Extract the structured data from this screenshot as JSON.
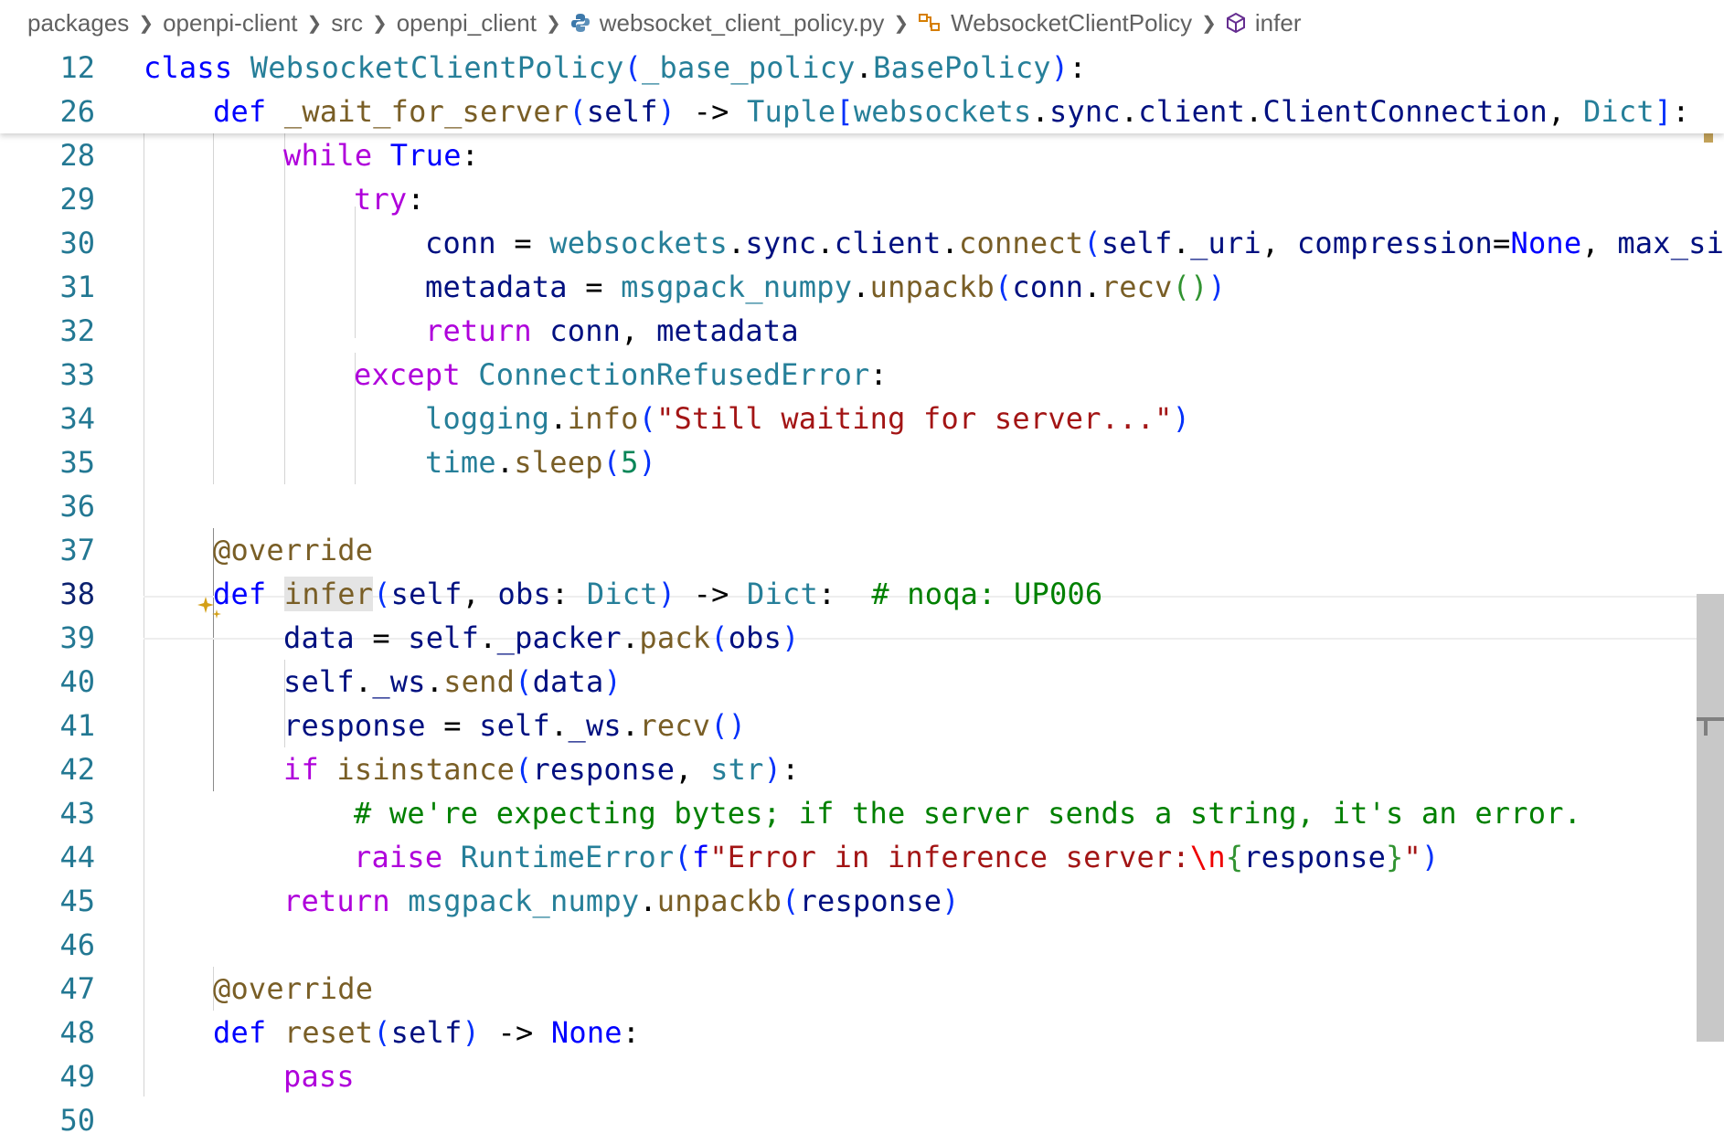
{
  "breadcrumb": {
    "items": [
      {
        "label": "packages",
        "icon": ""
      },
      {
        "label": "openpi-client",
        "icon": ""
      },
      {
        "label": "src",
        "icon": ""
      },
      {
        "label": "openpi_client",
        "icon": ""
      },
      {
        "label": "websocket_client_policy.py",
        "icon": "python-file-icon"
      },
      {
        "label": "WebsocketClientPolicy",
        "icon": "class-symbol-icon"
      },
      {
        "label": "infer",
        "icon": "method-symbol-icon"
      }
    ]
  },
  "editor": {
    "active_line": "38",
    "highlighted_symbol": "infer",
    "lines": [
      {
        "n": "12"
      },
      {
        "n": "26"
      },
      {
        "n": "28"
      },
      {
        "n": "29"
      },
      {
        "n": "30"
      },
      {
        "n": "31"
      },
      {
        "n": "32"
      },
      {
        "n": "33"
      },
      {
        "n": "34"
      },
      {
        "n": "35"
      },
      {
        "n": "36"
      },
      {
        "n": "37"
      },
      {
        "n": "38"
      },
      {
        "n": "39"
      },
      {
        "n": "40"
      },
      {
        "n": "41"
      },
      {
        "n": "42"
      },
      {
        "n": "43"
      },
      {
        "n": "44"
      },
      {
        "n": "45"
      },
      {
        "n": "46"
      },
      {
        "n": "47"
      },
      {
        "n": "48"
      },
      {
        "n": "49"
      },
      {
        "n": "50"
      }
    ],
    "tokens": {
      "l12": [
        "class",
        " ",
        "WebsocketClientPolicy",
        "(",
        "_base_policy",
        ".",
        "BasePolicy",
        ")",
        ":"
      ],
      "l26": [
        "def",
        " ",
        "_wait_for_server",
        "(",
        "self",
        ")",
        " -> ",
        "Tuple",
        "[",
        "websockets",
        ".",
        "sync",
        ".",
        "client",
        ".",
        "ClientConnection",
        ", ",
        "Dict",
        "]",
        ":"
      ],
      "l28": [
        "while",
        " ",
        "True",
        ":"
      ],
      "l29": [
        "try",
        ":"
      ],
      "l30": [
        "conn",
        " = ",
        "websockets",
        ".",
        "sync",
        ".",
        "client",
        ".",
        "connect",
        "(",
        "self",
        ".",
        "_uri",
        ", ",
        "compression",
        "=",
        "None",
        ", ",
        "max_siz"
      ],
      "l31": [
        "metadata",
        " = ",
        "msgpack_numpy",
        ".",
        "unpackb",
        "(",
        "conn",
        ".",
        "recv",
        "()",
        ")"
      ],
      "l32": [
        "return",
        " ",
        "conn",
        ", ",
        "metadata"
      ],
      "l33": [
        "except",
        " ",
        "ConnectionRefusedError",
        ":"
      ],
      "l34": [
        "logging",
        ".",
        "info",
        "(",
        "\"Still waiting for server...\"",
        ")"
      ],
      "l35": [
        "time",
        ".",
        "sleep",
        "(",
        "5",
        ")"
      ],
      "l37": [
        "@override"
      ],
      "l38": [
        "def",
        " ",
        "infer",
        "(",
        "self",
        ", ",
        "obs",
        ": ",
        "Dict",
        ")",
        " -> ",
        "Dict",
        ":  ",
        "# noqa: UP006"
      ],
      "l39": [
        "data",
        " = ",
        "self",
        ".",
        "_packer",
        ".",
        "pack",
        "(",
        "obs",
        ")"
      ],
      "l40": [
        "self",
        ".",
        "_ws",
        ".",
        "send",
        "(",
        "data",
        ")"
      ],
      "l41": [
        "response",
        " = ",
        "self",
        ".",
        "_ws",
        ".",
        "recv",
        "()"
      ],
      "l42": [
        "if",
        " ",
        "isinstance",
        "(",
        "response",
        ", ",
        "str",
        ")",
        ":"
      ],
      "l43": [
        "# we're expecting bytes; if the server sends a string, it's an error."
      ],
      "l44": [
        "raise",
        " ",
        "RuntimeError",
        "(",
        "f",
        "\"Error in inference server:",
        "\\n",
        "{",
        "response",
        "}",
        "\"",
        ")"
      ],
      "l45": [
        "return",
        " ",
        "msgpack_numpy",
        ".",
        "unpackb",
        "(",
        "response",
        ")"
      ],
      "l47": [
        "@override"
      ],
      "l48": [
        "def",
        " ",
        "reset",
        "(",
        "self",
        ")",
        " -> ",
        "None",
        ":"
      ],
      "l49": [
        "pass"
      ]
    }
  },
  "icons": {
    "sparkle": "sparkle-ai-icon",
    "sparkle_color": "#d4a017"
  },
  "colors": {
    "keyword": "#0000ff",
    "control": "#af00db",
    "type": "#267f99",
    "function": "#795e26",
    "variable": "#001080",
    "string": "#a31515",
    "comment": "#008000",
    "number": "#098658",
    "line_number": "#237893"
  }
}
